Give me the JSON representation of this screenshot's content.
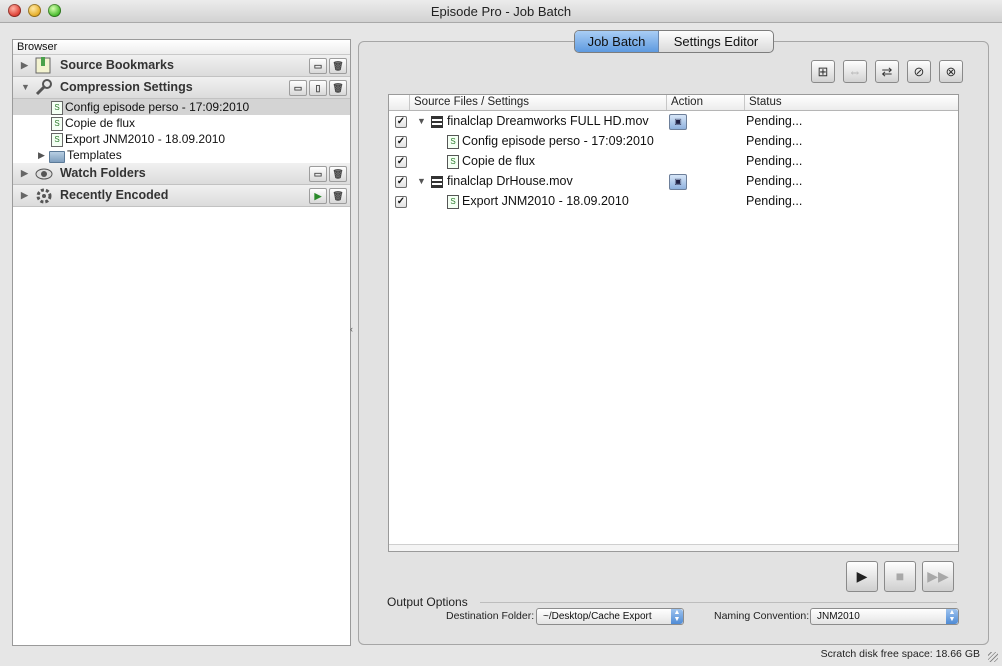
{
  "window": {
    "title": "Episode Pro - Job Batch"
  },
  "browser": {
    "header": "Browser",
    "sections": {
      "bookmarks": "Source Bookmarks",
      "compression": "Compression Settings",
      "watch": "Watch Folders",
      "recent": "Recently Encoded"
    },
    "compression_items": [
      "Config episode perso - 17:09:2010",
      "Copie de flux",
      "Export JNM2010 - 18.09.2010",
      "Templates"
    ]
  },
  "tabs": {
    "job_batch": "Job Batch",
    "settings_editor": "Settings Editor"
  },
  "table": {
    "columns": [
      "Source Files / Settings",
      "Action",
      "Status"
    ],
    "rows": [
      {
        "name": "finalclap Dreamworks FULL HD.mov",
        "status": "Pending..."
      },
      {
        "name": "Config episode perso - 17:09:2010",
        "status": "Pending..."
      },
      {
        "name": "Copie de flux",
        "status": "Pending..."
      },
      {
        "name": "finalclap DrHouse.mov",
        "status": "Pending..."
      },
      {
        "name": "Export JNM2010 - 18.09.2010",
        "status": "Pending..."
      }
    ]
  },
  "output": {
    "title": "Output Options",
    "destination_label": "Destination Folder:",
    "destination_value": "~/Desktop/Cache Export",
    "naming_label": "Naming Convention:",
    "naming_value": "JNM2010"
  },
  "status": {
    "scratch": "Scratch disk free space: 18.66 GB"
  },
  "icons": {
    "toolbar": [
      "add-file-icon",
      "link-icon",
      "refresh-icon",
      "stop-icon",
      "remove-icon"
    ],
    "playback": [
      "play-icon",
      "stop-icon",
      "skip-icon"
    ]
  }
}
